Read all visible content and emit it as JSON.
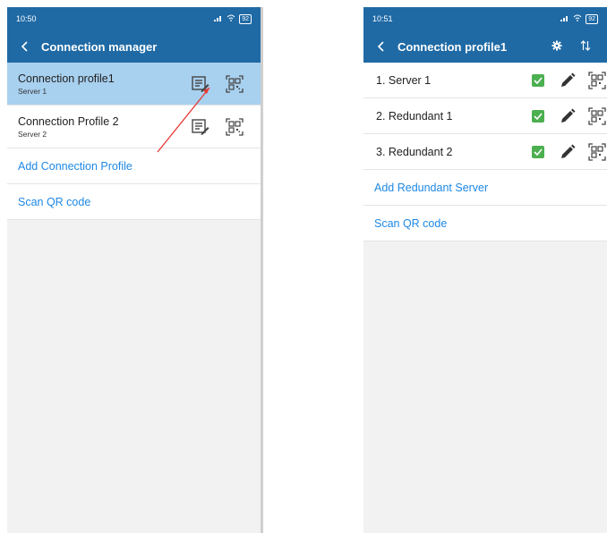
{
  "left": {
    "status": {
      "time": "10:50",
      "battery": "92"
    },
    "title": "Connection manager",
    "profiles": [
      {
        "name": "Connection profile1",
        "server": "Server 1"
      },
      {
        "name": "Connection Profile 2",
        "server": "Server 2"
      }
    ],
    "add_label": "Add Connection Profile",
    "scan_label": "Scan QR code"
  },
  "right": {
    "status": {
      "time": "10:51",
      "battery": "92"
    },
    "title": "Connection profile1",
    "servers": [
      {
        "label": "1. Server 1"
      },
      {
        "label": "2. Redundant 1"
      },
      {
        "label": "3. Redundant 2"
      }
    ],
    "add_label": "Add Redundant Server",
    "scan_label": "Scan QR code"
  },
  "colors": {
    "appbar": "#1f6aa5",
    "selected_row": "#a8d0ef",
    "link": "#1e88e5",
    "check": "#4caf50",
    "annotation_arrow": "#e53935"
  },
  "icons": {
    "back": "back-arrow-icon",
    "edit_profile": "edit-list-icon",
    "qr": "qr-code-icon",
    "settings": "gear-icon",
    "sort": "sort-icon",
    "check": "checkbox-checked-icon",
    "edit_server": "pencil-icon"
  }
}
